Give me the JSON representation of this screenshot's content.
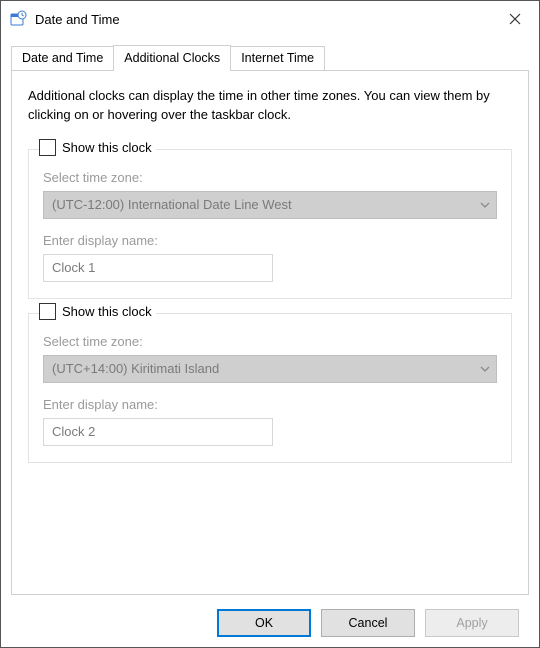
{
  "window": {
    "title": "Date and Time"
  },
  "tabs": [
    {
      "label": "Date and Time"
    },
    {
      "label": "Additional Clocks"
    },
    {
      "label": "Internet Time"
    }
  ],
  "intro": "Additional clocks can display the time in other time zones. You can view them by clicking on or hovering over the taskbar clock.",
  "clocks": [
    {
      "show_label": "Show this clock",
      "checked": false,
      "tz_label": "Select time zone:",
      "tz_value": "(UTC-12:00) International Date Line West",
      "name_label": "Enter display name:",
      "name_value": "Clock 1"
    },
    {
      "show_label": "Show this clock",
      "checked": false,
      "tz_label": "Select time zone:",
      "tz_value": "(UTC+14:00) Kiritimati Island",
      "name_label": "Enter display name:",
      "name_value": "Clock 2"
    }
  ],
  "buttons": {
    "ok": "OK",
    "cancel": "Cancel",
    "apply": "Apply"
  }
}
